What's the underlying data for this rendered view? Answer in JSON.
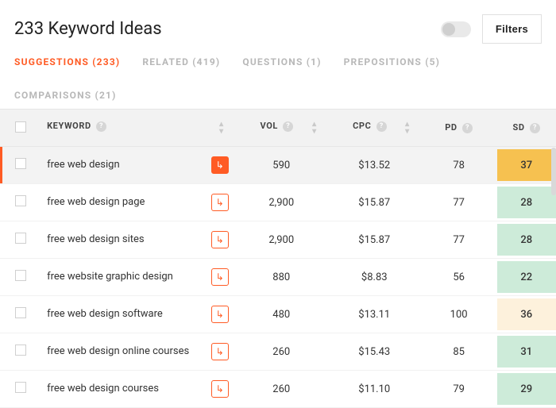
{
  "header": {
    "title": "233 Keyword Ideas",
    "filters_label": "Filters"
  },
  "tabs": [
    {
      "label": "SUGGESTIONS (233)",
      "active": true
    },
    {
      "label": "RELATED (419)",
      "active": false
    },
    {
      "label": "QUESTIONS (1)",
      "active": false
    },
    {
      "label": "PREPOSITIONS (5)",
      "active": false
    },
    {
      "label": "COMPARISONS (21)",
      "active": false
    }
  ],
  "columns": {
    "keyword": "KEYWORD",
    "vol": "VOL",
    "cpc": "CPC",
    "pd": "PD",
    "sd": "SD"
  },
  "rows": [
    {
      "keyword": "free web design",
      "vol": "590",
      "cpc": "$13.52",
      "pd": "78",
      "sd": "37",
      "sd_color": "#f6c150",
      "selected": true
    },
    {
      "keyword": "free web design page",
      "vol": "2,900",
      "cpc": "$15.87",
      "pd": "77",
      "sd": "28",
      "sd_color": "#cdebd9",
      "selected": false
    },
    {
      "keyword": "free web design sites",
      "vol": "2,900",
      "cpc": "$15.87",
      "pd": "77",
      "sd": "28",
      "sd_color": "#cdebd9",
      "selected": false
    },
    {
      "keyword": "free website graphic design",
      "vol": "880",
      "cpc": "$8.83",
      "pd": "56",
      "sd": "22",
      "sd_color": "#cdebd9",
      "selected": false
    },
    {
      "keyword": "free web design software",
      "vol": "480",
      "cpc": "$13.11",
      "pd": "100",
      "sd": "36",
      "sd_color": "#fdf1dc",
      "selected": false
    },
    {
      "keyword": "free web design online courses",
      "vol": "260",
      "cpc": "$15.43",
      "pd": "85",
      "sd": "31",
      "sd_color": "#cdebd9",
      "selected": false
    },
    {
      "keyword": "free web design courses",
      "vol": "260",
      "cpc": "$11.10",
      "pd": "79",
      "sd": "29",
      "sd_color": "#cdebd9",
      "selected": false
    }
  ]
}
